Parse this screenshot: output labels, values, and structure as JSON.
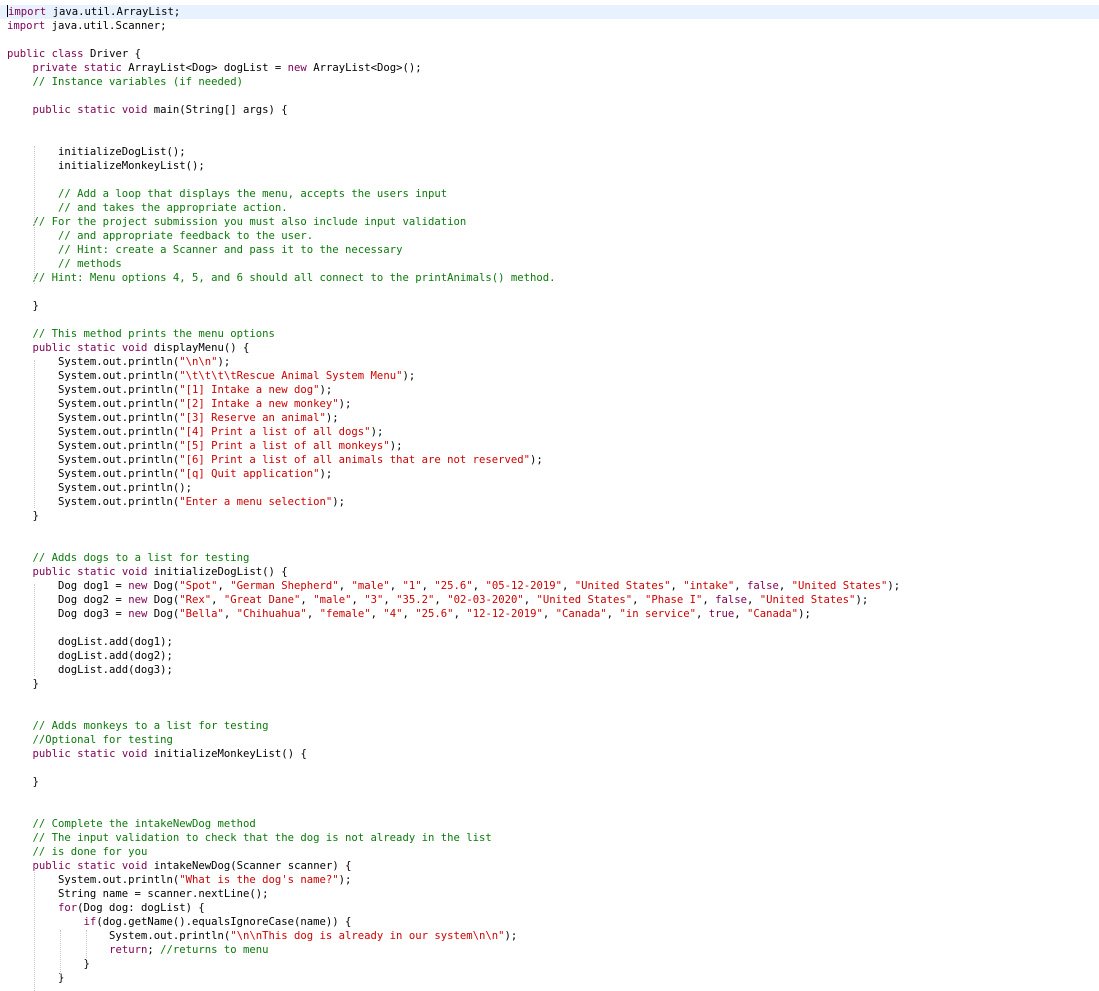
{
  "editor": {
    "language": "Java",
    "colors": {
      "background": "#ffffff",
      "keyword": "#7f0055",
      "string": "#d00000",
      "comment": "#0b7a0b",
      "current_line": "#e8f2fe"
    },
    "lines": [
      [
        [
          "kw",
          "import"
        ],
        [
          "p",
          " java.util.ArrayList;"
        ]
      ],
      [
        [
          "kw",
          "import"
        ],
        [
          "p",
          " java.util.Scanner;"
        ]
      ],
      [],
      [
        [
          "kw",
          "public"
        ],
        [
          "p",
          " "
        ],
        [
          "kw",
          "class"
        ],
        [
          "p",
          " Driver {"
        ]
      ],
      [
        [
          "p",
          "    "
        ],
        [
          "kw",
          "private"
        ],
        [
          "p",
          " "
        ],
        [
          "kw",
          "static"
        ],
        [
          "p",
          " ArrayList<Dog> dogList = "
        ],
        [
          "kw",
          "new"
        ],
        [
          "p",
          " ArrayList<Dog>();"
        ]
      ],
      [
        [
          "p",
          "    "
        ],
        [
          "com",
          "// Instance variables (if needed)"
        ]
      ],
      [],
      [
        [
          "p",
          "    "
        ],
        [
          "kw",
          "public"
        ],
        [
          "p",
          " "
        ],
        [
          "kw",
          "static"
        ],
        [
          "p",
          " "
        ],
        [
          "kw",
          "void"
        ],
        [
          "p",
          " main(String[] args) {"
        ]
      ],
      [],
      [],
      [
        [
          "p",
          "        initializeDogList();"
        ]
      ],
      [
        [
          "p",
          "        initializeMonkeyList();"
        ]
      ],
      [],
      [
        [
          "p",
          "        "
        ],
        [
          "com",
          "// Add a loop that displays the menu, accepts the users input"
        ]
      ],
      [
        [
          "p",
          "        "
        ],
        [
          "com",
          "// and takes the appropriate action."
        ]
      ],
      [
        [
          "p",
          "    "
        ],
        [
          "com",
          "// For the project submission you must also include input validation"
        ]
      ],
      [
        [
          "p",
          "        "
        ],
        [
          "com",
          "// and appropriate feedback to the user."
        ]
      ],
      [
        [
          "p",
          "        "
        ],
        [
          "com",
          "// Hint: create a Scanner and pass it to the necessary"
        ]
      ],
      [
        [
          "p",
          "        "
        ],
        [
          "com",
          "// methods"
        ]
      ],
      [
        [
          "p",
          "    "
        ],
        [
          "com",
          "// Hint: Menu options 4, 5, and 6 should all connect to the printAnimals() method."
        ]
      ],
      [],
      [
        [
          "p",
          "    }"
        ]
      ],
      [],
      [
        [
          "p",
          "    "
        ],
        [
          "com",
          "// This method prints the menu options"
        ]
      ],
      [
        [
          "p",
          "    "
        ],
        [
          "kw",
          "public"
        ],
        [
          "p",
          " "
        ],
        [
          "kw",
          "static"
        ],
        [
          "p",
          " "
        ],
        [
          "kw",
          "void"
        ],
        [
          "p",
          " displayMenu() {"
        ]
      ],
      [
        [
          "p",
          "        System.out.println("
        ],
        [
          "str",
          "\"\\n\\n\""
        ],
        [
          "p",
          ");"
        ]
      ],
      [
        [
          "p",
          "        System.out.println("
        ],
        [
          "str",
          "\"\\t\\t\\t\\tRescue Animal System Menu\""
        ],
        [
          "p",
          ");"
        ]
      ],
      [
        [
          "p",
          "        System.out.println("
        ],
        [
          "str",
          "\"[1] Intake a new dog\""
        ],
        [
          "p",
          ");"
        ]
      ],
      [
        [
          "p",
          "        System.out.println("
        ],
        [
          "str",
          "\"[2] Intake a new monkey\""
        ],
        [
          "p",
          ");"
        ]
      ],
      [
        [
          "p",
          "        System.out.println("
        ],
        [
          "str",
          "\"[3] Reserve an animal\""
        ],
        [
          "p",
          ");"
        ]
      ],
      [
        [
          "p",
          "        System.out.println("
        ],
        [
          "str",
          "\"[4] Print a list of all dogs\""
        ],
        [
          "p",
          ");"
        ]
      ],
      [
        [
          "p",
          "        System.out.println("
        ],
        [
          "str",
          "\"[5] Print a list of all monkeys\""
        ],
        [
          "p",
          ");"
        ]
      ],
      [
        [
          "p",
          "        System.out.println("
        ],
        [
          "str",
          "\"[6] Print a list of all animals that are not reserved\""
        ],
        [
          "p",
          ");"
        ]
      ],
      [
        [
          "p",
          "        System.out.println("
        ],
        [
          "str",
          "\"[q] Quit application\""
        ],
        [
          "p",
          ");"
        ]
      ],
      [
        [
          "p",
          "        System.out.println();"
        ]
      ],
      [
        [
          "p",
          "        System.out.println("
        ],
        [
          "str",
          "\"Enter a menu selection\""
        ],
        [
          "p",
          ");"
        ]
      ],
      [
        [
          "p",
          "    }"
        ]
      ],
      [],
      [],
      [
        [
          "p",
          "    "
        ],
        [
          "com",
          "// Adds dogs to a list for testing"
        ]
      ],
      [
        [
          "p",
          "    "
        ],
        [
          "kw",
          "public"
        ],
        [
          "p",
          " "
        ],
        [
          "kw",
          "static"
        ],
        [
          "p",
          " "
        ],
        [
          "kw",
          "void"
        ],
        [
          "p",
          " initializeDogList() {"
        ]
      ],
      [
        [
          "p",
          "        Dog dog1 = "
        ],
        [
          "kw",
          "new"
        ],
        [
          "p",
          " Dog("
        ],
        [
          "str",
          "\"Spot\""
        ],
        [
          "p",
          ", "
        ],
        [
          "str",
          "\"German Shepherd\""
        ],
        [
          "p",
          ", "
        ],
        [
          "str",
          "\"male\""
        ],
        [
          "p",
          ", "
        ],
        [
          "str",
          "\"1\""
        ],
        [
          "p",
          ", "
        ],
        [
          "str",
          "\"25.6\""
        ],
        [
          "p",
          ", "
        ],
        [
          "str",
          "\"05-12-2019\""
        ],
        [
          "p",
          ", "
        ],
        [
          "str",
          "\"United States\""
        ],
        [
          "p",
          ", "
        ],
        [
          "str",
          "\"intake\""
        ],
        [
          "p",
          ", "
        ],
        [
          "kw",
          "false"
        ],
        [
          "p",
          ", "
        ],
        [
          "str",
          "\"United States\""
        ],
        [
          "p",
          ");"
        ]
      ],
      [
        [
          "p",
          "        Dog dog2 = "
        ],
        [
          "kw",
          "new"
        ],
        [
          "p",
          " Dog("
        ],
        [
          "str",
          "\"Rex\""
        ],
        [
          "p",
          ", "
        ],
        [
          "str",
          "\"Great Dane\""
        ],
        [
          "p",
          ", "
        ],
        [
          "str",
          "\"male\""
        ],
        [
          "p",
          ", "
        ],
        [
          "str",
          "\"3\""
        ],
        [
          "p",
          ", "
        ],
        [
          "str",
          "\"35.2\""
        ],
        [
          "p",
          ", "
        ],
        [
          "str",
          "\"02-03-2020\""
        ],
        [
          "p",
          ", "
        ],
        [
          "str",
          "\"United States\""
        ],
        [
          "p",
          ", "
        ],
        [
          "str",
          "\"Phase I\""
        ],
        [
          "p",
          ", "
        ],
        [
          "kw",
          "false"
        ],
        [
          "p",
          ", "
        ],
        [
          "str",
          "\"United States\""
        ],
        [
          "p",
          ");"
        ]
      ],
      [
        [
          "p",
          "        Dog dog3 = "
        ],
        [
          "kw",
          "new"
        ],
        [
          "p",
          " Dog("
        ],
        [
          "str",
          "\"Bella\""
        ],
        [
          "p",
          ", "
        ],
        [
          "str",
          "\"Chihuahua\""
        ],
        [
          "p",
          ", "
        ],
        [
          "str",
          "\"female\""
        ],
        [
          "p",
          ", "
        ],
        [
          "str",
          "\"4\""
        ],
        [
          "p",
          ", "
        ],
        [
          "str",
          "\"25.6\""
        ],
        [
          "p",
          ", "
        ],
        [
          "str",
          "\"12-12-2019\""
        ],
        [
          "p",
          ", "
        ],
        [
          "str",
          "\"Canada\""
        ],
        [
          "p",
          ", "
        ],
        [
          "str",
          "\"in service\""
        ],
        [
          "p",
          ", "
        ],
        [
          "kw",
          "true"
        ],
        [
          "p",
          ", "
        ],
        [
          "str",
          "\"Canada\""
        ],
        [
          "p",
          ");"
        ]
      ],
      [],
      [
        [
          "p",
          "        dogList.add(dog1);"
        ]
      ],
      [
        [
          "p",
          "        dogList.add(dog2);"
        ]
      ],
      [
        [
          "p",
          "        dogList.add(dog3);"
        ]
      ],
      [
        [
          "p",
          "    }"
        ]
      ],
      [],
      [],
      [
        [
          "p",
          "    "
        ],
        [
          "com",
          "// Adds monkeys to a list for testing"
        ]
      ],
      [
        [
          "p",
          "    "
        ],
        [
          "com",
          "//Optional for testing"
        ]
      ],
      [
        [
          "p",
          "    "
        ],
        [
          "kw",
          "public"
        ],
        [
          "p",
          " "
        ],
        [
          "kw",
          "static"
        ],
        [
          "p",
          " "
        ],
        [
          "kw",
          "void"
        ],
        [
          "p",
          " initializeMonkeyList() {"
        ]
      ],
      [],
      [
        [
          "p",
          "    }"
        ]
      ],
      [],
      [],
      [
        [
          "p",
          "    "
        ],
        [
          "com",
          "// Complete the intakeNewDog method"
        ]
      ],
      [
        [
          "p",
          "    "
        ],
        [
          "com",
          "// The input validation to check that the dog is not already in the list"
        ]
      ],
      [
        [
          "p",
          "    "
        ],
        [
          "com",
          "// is done for you"
        ]
      ],
      [
        [
          "p",
          "    "
        ],
        [
          "kw",
          "public"
        ],
        [
          "p",
          " "
        ],
        [
          "kw",
          "static"
        ],
        [
          "p",
          " "
        ],
        [
          "kw",
          "void"
        ],
        [
          "p",
          " intakeNewDog(Scanner scanner) {"
        ]
      ],
      [
        [
          "p",
          "        System.out.println("
        ],
        [
          "str",
          "\"What is the dog's name?\""
        ],
        [
          "p",
          ");"
        ]
      ],
      [
        [
          "p",
          "        String name = scanner.nextLine();"
        ]
      ],
      [
        [
          "p",
          "        "
        ],
        [
          "kw",
          "for"
        ],
        [
          "p",
          "(Dog dog: dogList) {"
        ]
      ],
      [
        [
          "p",
          "            "
        ],
        [
          "kw",
          "if"
        ],
        [
          "p",
          "(dog.getName().equalsIgnoreCase(name)) {"
        ]
      ],
      [
        [
          "p",
          "                System.out.println("
        ],
        [
          "str",
          "\"\\n\\nThis dog is already in our system\\n\\n\""
        ],
        [
          "p",
          ");"
        ]
      ],
      [
        [
          "p",
          "                "
        ],
        [
          "kw",
          "return"
        ],
        [
          "p",
          "; "
        ],
        [
          "com",
          "//returns to menu"
        ]
      ],
      [
        [
          "p",
          "            }"
        ]
      ],
      [
        [
          "p",
          "        }"
        ]
      ]
    ]
  }
}
